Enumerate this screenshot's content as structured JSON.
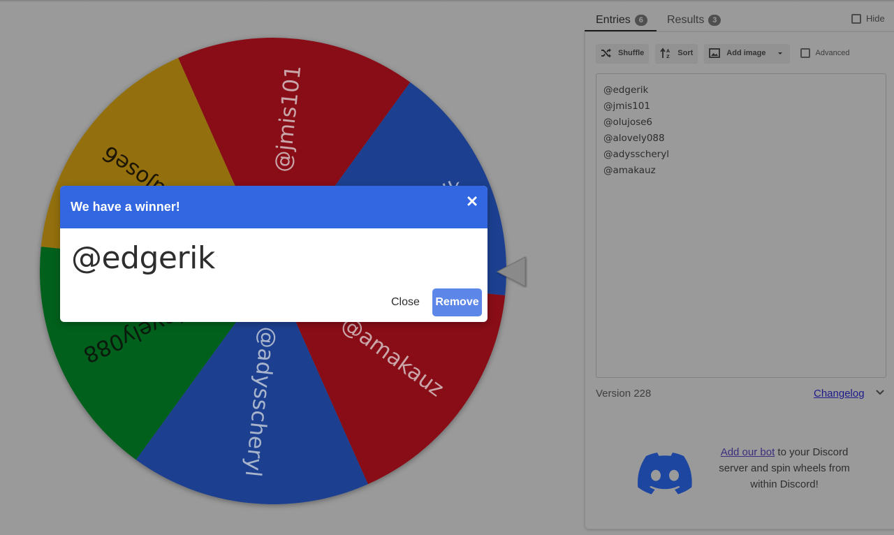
{
  "wheel": {
    "slices": [
      {
        "label": "@amakauz",
        "color": "#880c18",
        "text_color": "#c9a6aa"
      },
      {
        "label": "@adysscheryl",
        "color": "#1f418f",
        "text_color": "#a8b3cc"
      },
      {
        "label": "@alovely088",
        "color": "#04601a",
        "text_color": "#0b1a0d"
      },
      {
        "label": "@olujose6",
        "color": "#93700b",
        "text_color": "#1d1603"
      },
      {
        "label": "@jmis101",
        "color": "#880c18",
        "text_color": "#c9a6aa"
      },
      {
        "label": "@edgerik",
        "color": "#1f418f",
        "text_color": "#a8b3cc"
      }
    ],
    "pointer_color": "#8a8a8a"
  },
  "tabs": [
    {
      "label": "Entries",
      "count": "6"
    },
    {
      "label": "Results",
      "count": "3"
    }
  ],
  "hide_label": "Hide",
  "toolbar": {
    "shuffle_label": "Shuffle",
    "sort_label": "Sort",
    "add_image_label": "Add image",
    "advanced_label": "Advanced"
  },
  "entries": [
    "@edgerik",
    "@jmis101",
    "@olujose6",
    "@alovely088",
    "@adysscheryl",
    "@amakauz"
  ],
  "footer": {
    "version": "Version 228",
    "changelog_label": "Changelog"
  },
  "discord": {
    "link_text": "Add our bot",
    "text_rest": " to your Discord server and spin wheels from within Discord!",
    "logo_color": "#1d46a0"
  },
  "modal": {
    "title": "We have a winner!",
    "winner": "@edgerik",
    "close_label": "Close",
    "remove_label": "Remove",
    "header_color": "#3367e1"
  }
}
